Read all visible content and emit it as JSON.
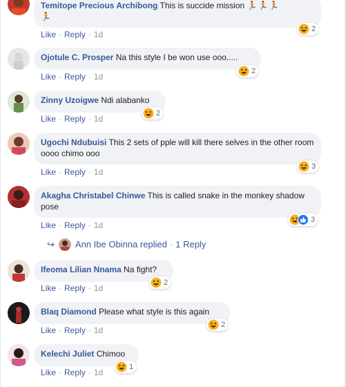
{
  "comments": [
    {
      "author": "Temitope Precious Archibong",
      "text": "This is succide mission",
      "actions": {
        "like": "Like",
        "reply": "Reply",
        "age": "1d"
      },
      "reaction": {
        "type": "haha",
        "count": "2"
      }
    },
    {
      "author": "Ojotule C. Prosper",
      "text": "Na this style I be won use ooo.....",
      "actions": {
        "like": "Like",
        "reply": "Reply",
        "age": "1d"
      },
      "reaction": {
        "type": "haha",
        "count": "2"
      }
    },
    {
      "author": "Zinny Uzoigwe",
      "text": "Ndi alabanko",
      "actions": {
        "like": "Like",
        "reply": "Reply",
        "age": "1d"
      },
      "reaction": {
        "type": "haha",
        "count": "2"
      }
    },
    {
      "author": "Ugochi Ndubuisi",
      "text": "This 2 sets of pple will kill there selves in the other room oooo chimo ooo",
      "actions": {
        "like": "Like",
        "reply": "Reply",
        "age": "1d"
      },
      "reaction": {
        "type": "haha",
        "count": "3"
      }
    },
    {
      "author": "Akagha Christabel Chinwe",
      "text": "This is called snake in the monkey shadow pose",
      "actions": {
        "like": "Like",
        "reply": "Reply",
        "age": "1d"
      },
      "reaction": {
        "type": "haha+like",
        "count": "3"
      }
    },
    {
      "author": "Ifeoma Lilian Nnama",
      "text": "Na fight?",
      "actions": {
        "like": "Like",
        "reply": "Reply",
        "age": "1d"
      },
      "reaction": {
        "type": "haha",
        "count": "2"
      }
    },
    {
      "author": "Blaq Diamond",
      "text": "Please what style is this again",
      "actions": {
        "like": "Like",
        "reply": "Reply",
        "age": "1d"
      },
      "reaction": {
        "type": "haha",
        "count": "2"
      }
    },
    {
      "author": "Kelechi Juliet",
      "text": "Chimoo",
      "actions": {
        "like": "Like",
        "reply": "Reply",
        "age": "1d"
      },
      "reaction": {
        "type": "haha",
        "count": "1"
      }
    }
  ],
  "reply_summary": {
    "name": "Ann Ibe Obinna replied",
    "count": "1 Reply"
  },
  "icons": {
    "reaction_haha": "laughing-face-icon",
    "reaction_like": "thumbs-up-icon",
    "runner": "running-person-emoji",
    "reply_arrow": "reply-arrow-icon"
  },
  "colors": {
    "author": "#385898",
    "bubble": "#f0f2f5",
    "like_blue": "#1877f2",
    "haha_yellow": "#f7b125"
  }
}
